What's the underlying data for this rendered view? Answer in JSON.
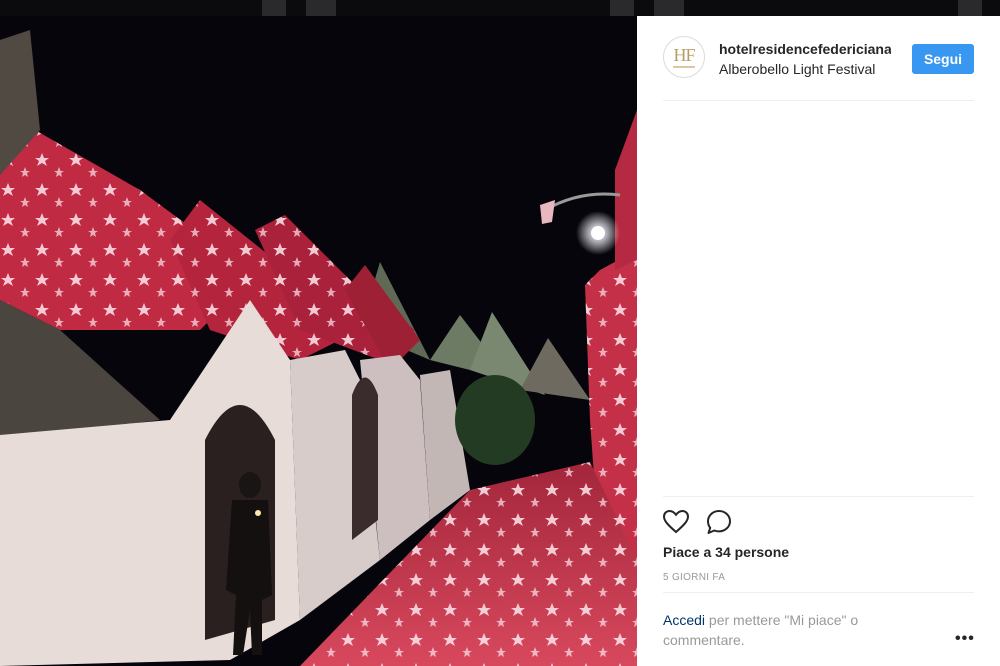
{
  "post": {
    "username": "hotelresidencefedericiana",
    "location": "Alberobello Light Festival",
    "follow_label": "Segui",
    "likes_text": "Piace a 34 persone",
    "time_text": "5 GIORNI FA",
    "login_link": "Accedi",
    "login_text": " per mettere \"Mi piace\" o commentare.",
    "more_label": "•••",
    "avatar_monogram": "HF"
  },
  "photo": {
    "alt": "Trulli houses of Alberobello lit with red star projections at night"
  },
  "icons": {
    "like": "heart-outline-icon",
    "comment": "comment-bubble-icon"
  },
  "colors": {
    "follow_button": "#3897f0",
    "link": "#003569",
    "muted_text": "#999999"
  }
}
